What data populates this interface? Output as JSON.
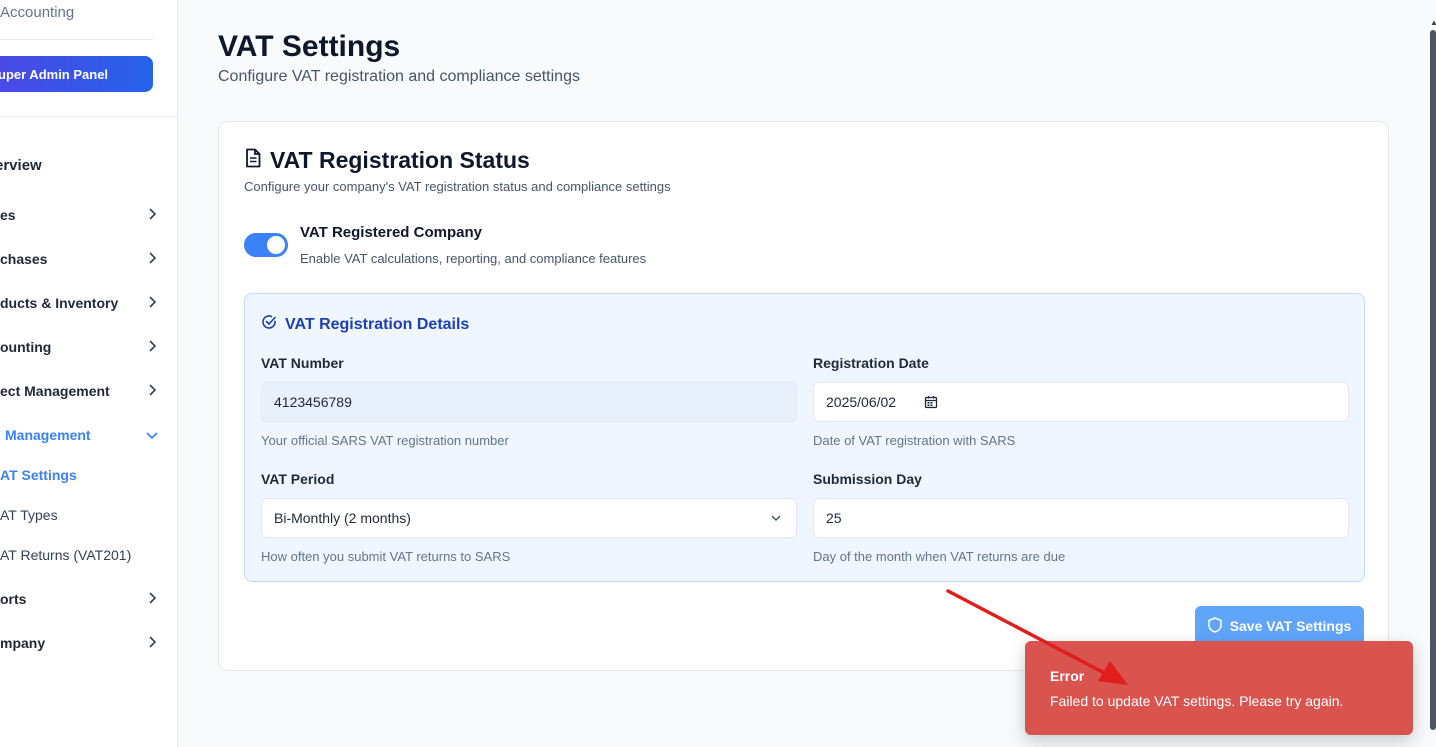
{
  "sidebar": {
    "brand_sub": "Accounting",
    "admin_button": "uper Admin Panel",
    "overview": "erview",
    "nav": [
      {
        "label": "es"
      },
      {
        "label": "chases"
      },
      {
        "label": "ducts & Inventory"
      },
      {
        "label": "ounting"
      },
      {
        "label": "ect Management"
      },
      {
        "label": "Management"
      },
      {
        "label": "orts"
      },
      {
        "label": "mpany"
      }
    ],
    "vat_sub": [
      {
        "label": "AT Settings"
      },
      {
        "label": "AT Types"
      },
      {
        "label": "AT Returns (VAT201)"
      }
    ]
  },
  "page": {
    "title": "VAT Settings",
    "subtitle": "Configure VAT registration and compliance settings"
  },
  "card": {
    "title": "VAT Registration Status",
    "subtitle": "Configure your company's VAT registration status and compliance settings",
    "toggle": {
      "label": "VAT Registered Company",
      "description": "Enable VAT calculations, reporting, and compliance features",
      "on": true
    },
    "details": {
      "title": "VAT Registration Details",
      "vat_number": {
        "label": "VAT Number",
        "value": "4123456789",
        "help": "Your official SARS VAT registration number"
      },
      "registration_date": {
        "label": "Registration Date",
        "value": "2025/06/02",
        "help": "Date of VAT registration with SARS"
      },
      "vat_period": {
        "label": "VAT Period",
        "value": "Bi-Monthly (2 months)",
        "help": "How often you submit VAT returns to SARS"
      },
      "submission_day": {
        "label": "Submission Day",
        "value": "25",
        "help": "Day of the month when VAT returns are due"
      }
    },
    "save_button": "Save VAT Settings"
  },
  "toast": {
    "title": "Error",
    "message": "Failed to update VAT settings. Please try again.",
    "color": "#d9534f"
  },
  "colors": {
    "accent": "#3b82f6",
    "annotation": "#e11d1d"
  }
}
